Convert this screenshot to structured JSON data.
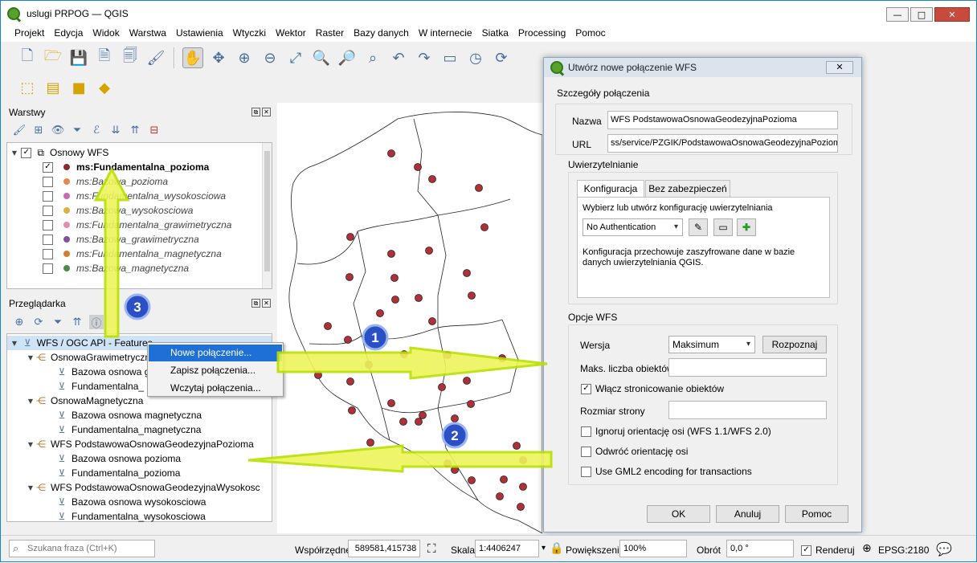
{
  "window": {
    "title": "uslugi PRPOG — QGIS",
    "min": "—",
    "max": "□",
    "close": "✕"
  },
  "menu": [
    "Projekt",
    "Edycja",
    "Widok",
    "Warstwa",
    "Ustawienia",
    "Wtyczki",
    "Wektor",
    "Raster",
    "Bazy danych",
    "W internecie",
    "Siatka",
    "Processing",
    "Pomoc"
  ],
  "layers_panel": {
    "title": "Warstwy",
    "group": "Osnowy WFS",
    "items": [
      {
        "label": "ms:Fundamentalna_pozioma",
        "checked": true,
        "color": "#8a2c2c"
      },
      {
        "label": "ms:Bazowa_pozioma",
        "checked": false,
        "color": "#e08a50"
      },
      {
        "label": "ms:Fundamentalna_wysokosciowa",
        "checked": false,
        "color": "#c86bb0"
      },
      {
        "label": "ms:Bazowa_wysokosciowa",
        "checked": false,
        "color": "#e0b040"
      },
      {
        "label": "ms:Fundamentalna_grawimetryczna",
        "checked": false,
        "color": "#e090b0"
      },
      {
        "label": "ms:Bazowa_grawimetryczna",
        "checked": false,
        "color": "#8050a0"
      },
      {
        "label": "ms:Fundamentalna_magnetyczna",
        "checked": false,
        "color": "#d08030"
      },
      {
        "label": "ms:Bazowa_magnetyczna",
        "checked": false,
        "color": "#4a8a4a"
      }
    ]
  },
  "browser_panel": {
    "title": "Przeglądarka",
    "root": "WFS / OGC API - Features",
    "rows": [
      {
        "label": "OsnowaGrawimetryczna",
        "level": 1,
        "type": "conn"
      },
      {
        "label": "Bazowa osnowa gr",
        "level": 2,
        "type": "layer"
      },
      {
        "label": "Fundamentalna_",
        "level": 2,
        "type": "layer"
      },
      {
        "label": "OsnowaMagnetyczna",
        "level": 1,
        "type": "conn"
      },
      {
        "label": "Bazowa osnowa magnetyczna",
        "level": 2,
        "type": "layer"
      },
      {
        "label": "Fundamentalna_magnetyczna",
        "level": 2,
        "type": "layer"
      },
      {
        "label": "WFS PodstawowaOsnowaGeodezyjnaPozioma",
        "level": 1,
        "type": "conn"
      },
      {
        "label": "Bazowa osnowa pozioma",
        "level": 2,
        "type": "layer"
      },
      {
        "label": "Fundamentalna_pozioma",
        "level": 2,
        "type": "layer"
      },
      {
        "label": "WFS PodstawowaOsnowaGeodezyjnaWysokosc",
        "level": 1,
        "type": "conn"
      },
      {
        "label": "Bazowa osnowa wysokosciowa",
        "level": 2,
        "type": "layer"
      },
      {
        "label": "Fundamentalna_wysokosciowa",
        "level": 2,
        "type": "layer"
      }
    ]
  },
  "context_menu": [
    "Nowe połączenie...",
    "Zapisz połączenia...",
    "Wczytaj połączenia..."
  ],
  "dialog": {
    "title": "Utwórz nowe połączenie WFS",
    "close": "✕",
    "details_heading": "Szczegóły połączenia",
    "name_label": "Nazwa",
    "name_value": "WFS PodstawowaOsnowaGeodezyjnaPozioma",
    "url_label": "URL",
    "url_value": "ss/service/PZGIK/PodstawowaOsnowaGeodezyjnaPozioma",
    "auth_heading": "Uwierzytelnianie",
    "tab_config": "Konfiguracja",
    "tab_basic": "Bez zabezpieczeń",
    "auth_prompt": "Wybierz lub utwórz konfigurację uwierzytelniania",
    "auth_combo": "No Authentication",
    "auth_note": "Konfiguracja przechowuje zaszyfrowane dane w bazie danych uwierzytelniania QGIS.",
    "wfs_heading": "Opcje WFS",
    "version_label": "Wersja",
    "version_value": "Maksimum",
    "detect_button": "Rozpoznaj",
    "max_label": "Maks. liczba obiektów",
    "max_value": "",
    "paging_label": "Włącz stronicowanie obiektów",
    "paging_checked": true,
    "page_size_label": "Rozmiar strony",
    "page_size_value": "",
    "ignore_axis": "Ignoruj orientację osi (WFS 1.1/WFS 2.0)",
    "invert_axis": "Odwróć orientację osi",
    "gml2": "Use GML2 encoding for transactions",
    "ok": "OK",
    "cancel": "Anuluj",
    "help": "Pomoc"
  },
  "status": {
    "search_placeholder": "Szukana fraza (Ctrl+K)",
    "coord_label": "Współrzędne",
    "coord_value": "589581,415738",
    "scale_label": "Skala",
    "scale_value": "1:4406247",
    "zoom_label": "Powiększenie",
    "zoom_value": "100%",
    "rotation_label": "Obrót",
    "rotation_value": "0,0 °",
    "render_label": "Renderuj",
    "render_checked": true,
    "crs": "EPSG:2180"
  },
  "callouts": [
    "1",
    "2",
    "3"
  ],
  "colors": {
    "accent": "#1e6fd6",
    "annotation": "#c8f000",
    "badge": "#2b4fc4",
    "feature": "#b0303a"
  }
}
